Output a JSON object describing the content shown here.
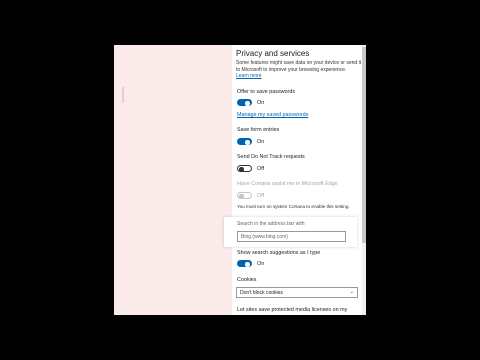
{
  "panel": {
    "title": "Privacy and services",
    "description_line1": "Some features might save data on your device or send it",
    "description_line2": "to Microsoft to improve your browsing experience.",
    "learn_more": "Learn more"
  },
  "settings": {
    "offer_save_passwords": {
      "label": "Offer to save passwords",
      "state": "On"
    },
    "manage_passwords_link": "Manage my saved passwords",
    "save_form_entries": {
      "label": "Save form entries",
      "state": "On"
    },
    "do_not_track": {
      "label": "Send Do Not Track requests",
      "state": "Off"
    },
    "cortana": {
      "label": "Have Cortana assist me in Microsoft Edge",
      "state": "Off",
      "note": "You must turn on system Cortana to enable this setting."
    },
    "address_bar": {
      "label": "Search in the address bar with",
      "value": "Bing (www.bing.com)"
    },
    "search_suggestions": {
      "label": "Show search suggestions as I type",
      "state": "On"
    },
    "cookies": {
      "label": "Cookies",
      "value": "Don't block cookies"
    },
    "media_licenses": {
      "label": "Let sites save protected media licenses on my"
    }
  },
  "colors": {
    "accent": "#0063b1",
    "left_pane": "#fbeaea",
    "panel_bg": "#ffffff"
  },
  "icons": {
    "dropdown": "chevron-down-icon"
  }
}
